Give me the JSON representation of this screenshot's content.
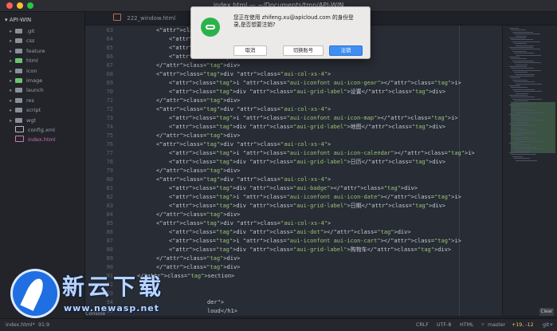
{
  "window": {
    "title": "index.html — ~/Documents/tmp/API-WIN"
  },
  "sidebar": {
    "root": "API-WIN",
    "items": [
      {
        "label": ".git",
        "type": "folder",
        "color": "#8a8f98"
      },
      {
        "label": "css",
        "type": "folder",
        "color": "#8a8f98"
      },
      {
        "label": "feature",
        "type": "folder",
        "color": "#8a8f98"
      },
      {
        "label": "html",
        "type": "folder",
        "color": "#6cc36f"
      },
      {
        "label": "icon",
        "type": "folder",
        "color": "#8a8f98"
      },
      {
        "label": "image",
        "type": "folder",
        "color": "#6cc36f"
      },
      {
        "label": "launch",
        "type": "folder",
        "color": "#8a8f98"
      },
      {
        "label": "res",
        "type": "folder",
        "color": "#8a8f98"
      },
      {
        "label": "script",
        "type": "folder",
        "color": "#8a8f98"
      },
      {
        "label": "wgt",
        "type": "folder",
        "color": "#8a8f98"
      },
      {
        "label": "config.xml",
        "type": "file",
        "color": "#b6bbc3"
      },
      {
        "label": "index.html",
        "type": "file",
        "color": "#ce7ab2"
      }
    ]
  },
  "tabs": [
    {
      "label": "222_window.html"
    }
  ],
  "editor": {
    "lines": [
      {
        "num": "63",
        "text": "<div class=\"aui-col-xs-4\">"
      },
      {
        "num": "64",
        "text": "<div"
      },
      {
        "num": "65",
        "text": "<i c"
      },
      {
        "num": "66",
        "text": "<div"
      },
      {
        "num": "67",
        "text": "</div>"
      },
      {
        "num": "68",
        "text": "<div class=\"aui-col-xs-4\">"
      },
      {
        "num": "69",
        "text": "<i class=\"aui-iconfont aui-icon-gear\"></i>"
      },
      {
        "num": "70",
        "text": "<div class=\"aui-grid-label\">设置</div>"
      },
      {
        "num": "71",
        "text": "</div>"
      },
      {
        "num": "72",
        "text": "<div class=\"aui-col-xs-4\">"
      },
      {
        "num": "73",
        "text": "<i class=\"aui-iconfont aui-icon-map\"></i>"
      },
      {
        "num": "74",
        "text": "<div class=\"aui-grid-label\">地图</div>"
      },
      {
        "num": "75",
        "text": "</div>"
      },
      {
        "num": "76",
        "text": "<div class=\"aui-col-xs-4\">"
      },
      {
        "num": "77",
        "text": "<i class=\"aui-iconfont aui-icon-calendar\"></i>"
      },
      {
        "num": "78",
        "text": "<div class=\"aui-grid-label\">日历</div>"
      },
      {
        "num": "79",
        "text": "</div>"
      },
      {
        "num": "80",
        "text": "<div class=\"aui-col-xs-4\">"
      },
      {
        "num": "81",
        "text": "<div class=\"aui-badge\"></div>"
      },
      {
        "num": "82",
        "text": "<i class=\"aui-iconfont aui-icon-date\"></i>"
      },
      {
        "num": "83",
        "text": "<div class=\"aui-grid-label\">日期</div>"
      },
      {
        "num": "84",
        "text": "</div>"
      },
      {
        "num": "85",
        "text": "<div class=\"aui-col-xs-4\">"
      },
      {
        "num": "86",
        "text": "<div class=\"aui-dot\"></div>"
      },
      {
        "num": "87",
        "text": "<i class=\"aui-iconfont aui-icon-cart\"></i>"
      },
      {
        "num": "88",
        "text": "<div class=\"aui-grid-label\">购物车</div>"
      },
      {
        "num": "89",
        "text": "</div>"
      },
      {
        "num": "90",
        "text": "</div>"
      },
      {
        "num": "91",
        "text": "</section>"
      },
      {
        "num": "92",
        "text": ""
      },
      {
        "num": "93",
        "text": ""
      },
      {
        "num": "94",
        "text": "der\">"
      },
      {
        "num": "95",
        "text": "loud</h1>"
      }
    ]
  },
  "dialog": {
    "message": "您正在使用 zhifeng.xu@apicloud.com 的身份登录,是否想要注销?",
    "buttons": {
      "cancel": "取消",
      "switch": "切换账号",
      "logout": "注销"
    }
  },
  "console": {
    "label": "Console",
    "clear": "Clear"
  },
  "statusbar": {
    "file": "index.html*",
    "cursor": "91:9",
    "line_ending": "CRLF",
    "encoding": "UTF-8",
    "grammar": "HTML",
    "branch": "master",
    "diff": "+19, -12",
    "git": "git+"
  },
  "watermark": {
    "title": "新云下载",
    "url": "www.newasp.net"
  }
}
